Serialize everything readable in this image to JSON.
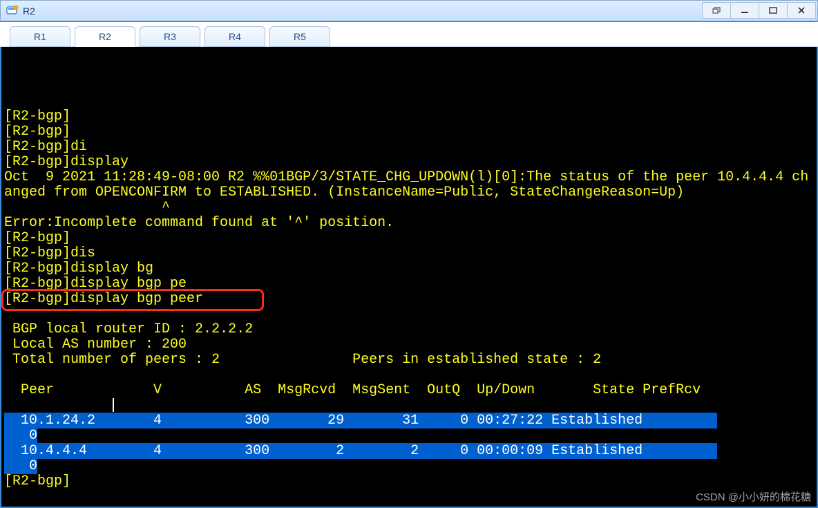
{
  "window": {
    "title": "R2"
  },
  "tabs": [
    {
      "label": "R1",
      "active": false
    },
    {
      "label": "R2",
      "active": true
    },
    {
      "label": "R3",
      "active": false
    },
    {
      "label": "R4",
      "active": false
    },
    {
      "label": "R5",
      "active": false
    }
  ],
  "terminal": {
    "lines": [
      "[R2-bgp]",
      "[R2-bgp]",
      "[R2-bgp]di",
      "[R2-bgp]display",
      "Oct  9 2021 11:28:49-08:00 R2 %%01BGP/3/STATE_CHG_UPDOWN(l)[0]:The status of the peer 10.4.4.4 changed from OPENCONFIRM to ESTABLISHED. (InstanceName=Public, StateChangeReason=Up)",
      "                   ^",
      "Error:Incomplete command found at '^' position.",
      "[R2-bgp]",
      "[R2-bgp]dis",
      "[R2-bgp]display bg",
      "[R2-bgp]display bgp pe",
      "[R2-bgp]display bgp peer",
      "",
      " BGP local router ID : 2.2.2.2",
      " Local AS number : 200",
      " Total number of peers : 2\t\t  Peers in established state : 2",
      "",
      "  Peer            V          AS  MsgRcvd  MsgSent  OutQ  Up/Down       State PrefRcv",
      ""
    ],
    "peers": [
      {
        "ip": "10.1.24.2",
        "v": 4,
        "as": 300,
        "msgRcvd": 29,
        "msgSent": 31,
        "outQ": 0,
        "upDown": "00:27:22",
        "state": "Established",
        "prefRcv": 0
      },
      {
        "ip": "10.4.4.4",
        "v": 4,
        "as": 300,
        "msgRcvd": 2,
        "msgSent": 2,
        "outQ": 0,
        "upDown": "00:00:09",
        "state": "Established",
        "prefRcv": 0
      }
    ],
    "final_prompt": "[R2-bgp]",
    "highlight_line_index": 11
  },
  "watermark": "CSDN @小小妍的棉花糖"
}
